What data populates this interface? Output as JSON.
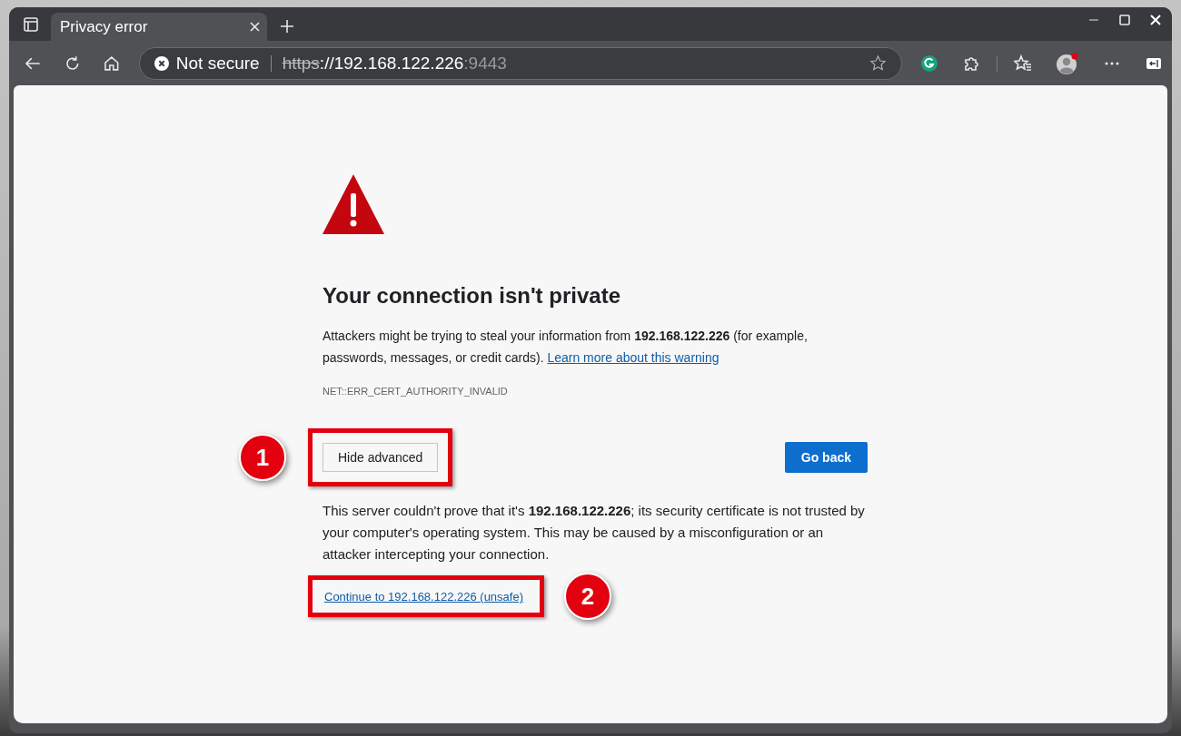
{
  "tab": {
    "title": "Privacy error"
  },
  "address_bar": {
    "security": "Not secure",
    "scheme": "https",
    "host": "://192.168.122.226",
    "port": ":9443"
  },
  "page": {
    "heading": "Your connection isn't private",
    "intro": "Attackers might be trying to steal your information from **192.168.122.226** (for example, passwords, messages, or credit cards).",
    "learn_more": "Learn more about this warning",
    "error_code": "NET::ERR_CERT_AUTHORITY_INVALID",
    "advanced_button": "Hide advanced",
    "back_button": "Go back",
    "details": "This server couldn't prove that it's **192.168.122.226**; its security certificate is not trusted by your computer's operating system. This may be caused by a misconfiguration or an attacker intercepting your connection.",
    "proceed_link": "Continue to 192.168.122.226 (unsafe)"
  },
  "callouts": [
    {
      "number": "1"
    },
    {
      "number": "2"
    }
  ]
}
